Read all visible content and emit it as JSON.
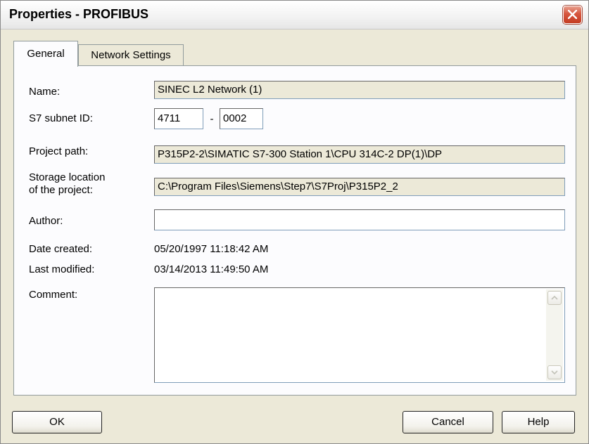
{
  "window": {
    "title": "Properties - PROFIBUS"
  },
  "tabs": [
    {
      "label": "General",
      "active": true
    },
    {
      "label": "Network Settings",
      "active": false
    }
  ],
  "form": {
    "name": {
      "label": "Name:",
      "value": "SINEC L2 Network (1)"
    },
    "subnet_id": {
      "label": "S7 subnet ID:",
      "part1": "4711",
      "separator": "-",
      "part2": "0002"
    },
    "project_path": {
      "label": "Project path:",
      "value": "P315P2-2\\SIMATIC S7-300 Station 1\\CPU 314C-2 DP(1)\\DP"
    },
    "storage_location": {
      "label_line1": "Storage location",
      "label_line2": "of the project:",
      "value": "C:\\Program Files\\Siemens\\Step7\\S7Proj\\P315P2_2"
    },
    "author": {
      "label": "Author:",
      "value": ""
    },
    "date_created": {
      "label": "Date created:",
      "value": "05/20/1997 11:18:42 AM"
    },
    "last_modified": {
      "label": "Last modified:",
      "value": "03/14/2013 11:49:50 AM"
    },
    "comment": {
      "label": "Comment:",
      "value": ""
    }
  },
  "buttons": {
    "ok": "OK",
    "cancel": "Cancel",
    "help": "Help"
  },
  "icons": {
    "close": "close-icon",
    "scroll_up": "scroll-up-icon",
    "scroll_down": "scroll-down-icon"
  }
}
